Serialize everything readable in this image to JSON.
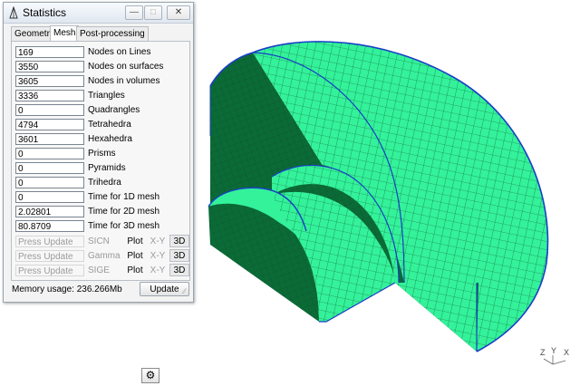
{
  "window": {
    "title": "Statistics"
  },
  "tabs": [
    "Geometry",
    "Mesh",
    "Post-processing"
  ],
  "stats": [
    {
      "value": "169",
      "label": "Nodes on Lines"
    },
    {
      "value": "3550",
      "label": "Nodes on surfaces"
    },
    {
      "value": "3605",
      "label": "Nodes in volumes"
    },
    {
      "value": "3336",
      "label": "Triangles"
    },
    {
      "value": "0",
      "label": "Quadrangles"
    },
    {
      "value": "4794",
      "label": "Tetrahedra"
    },
    {
      "value": "3601",
      "label": "Hexahedra"
    },
    {
      "value": "0",
      "label": "Prisms"
    },
    {
      "value": "0",
      "label": "Pyramids"
    },
    {
      "value": "0",
      "label": "Trihedra"
    },
    {
      "value": "0",
      "label": "Time for 1D mesh"
    },
    {
      "value": "2.02801",
      "label": "Time for 2D mesh"
    },
    {
      "value": "80.8709",
      "label": "Time for 3D mesh"
    }
  ],
  "quality": [
    {
      "value": "Press Update",
      "label": "SICN"
    },
    {
      "value": "Press Update",
      "label": "Gamma"
    },
    {
      "value": "Press Update",
      "label": "SIGE"
    }
  ],
  "quality_buttons": {
    "plot": "Plot",
    "xy": "X-Y",
    "d3": "3D"
  },
  "memory": "Memory usage: 236.266Mb",
  "update_label": "Update",
  "axes": {
    "x": "X",
    "y": "Y",
    "z": "Z"
  },
  "colors": {
    "mesh_face": "#33f29a",
    "mesh_dark": "#0b6b37",
    "edge": "#1a3fc8"
  }
}
